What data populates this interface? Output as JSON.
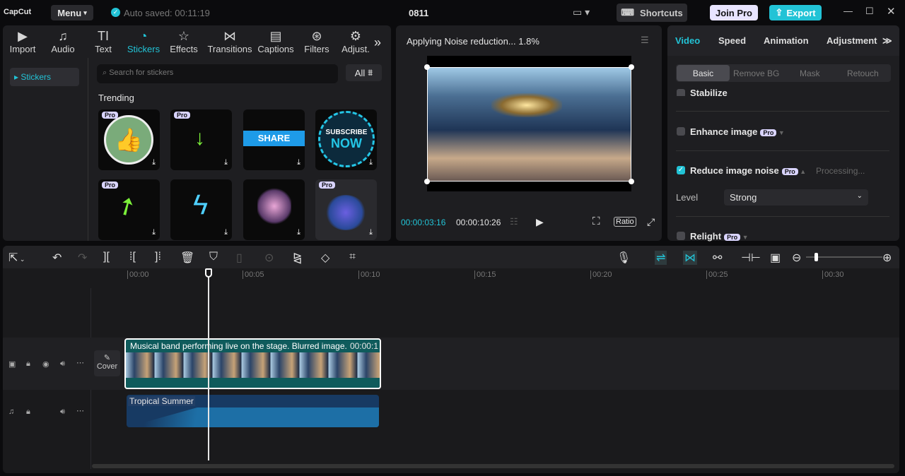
{
  "app": {
    "logo": "CapCut",
    "menu": "Menu",
    "autosave": "Auto saved: 00:11:19",
    "project": "0811",
    "shortcuts": "Shortcuts",
    "join_pro": "Join Pro",
    "export": "Export"
  },
  "toolbar": [
    {
      "label": "Import",
      "icon": "import-icon"
    },
    {
      "label": "Audio",
      "icon": "audio-icon"
    },
    {
      "label": "Text",
      "icon": "text-icon"
    },
    {
      "label": "Stickers",
      "icon": "stickers-icon"
    },
    {
      "label": "Effects",
      "icon": "effects-icon"
    },
    {
      "label": "Transitions",
      "icon": "transitions-icon"
    },
    {
      "label": "Captions",
      "icon": "captions-icon"
    },
    {
      "label": "Filters",
      "icon": "filters-icon"
    },
    {
      "label": "Adjust.",
      "icon": "adjust-icon"
    }
  ],
  "stickers": {
    "side_item": "Stickers",
    "search_placeholder": "Search for stickers",
    "filter": "All",
    "section": "Trending",
    "pro": "Pro",
    "share": "SHARE",
    "subscribe": "SUBSCRIBE",
    "now": "NOW"
  },
  "preview": {
    "status": "Applying Noise reduction... 1.8%",
    "current": "00:00:03:16",
    "total": "00:00:10:26",
    "ratio": "Ratio"
  },
  "right": {
    "tabs": [
      "Video",
      "Speed",
      "Animation",
      "Adjustment"
    ],
    "subtabs": [
      "Basic",
      "Remove BG",
      "Mask",
      "Retouch"
    ],
    "stabilize": "Stabilize",
    "enhance": "Enhance image",
    "reduce": "Reduce image noise",
    "processing": "Processing...",
    "level_label": "Level",
    "level_value": "Strong",
    "relight": "Relight",
    "pro": "Pro"
  },
  "timeline": {
    "ticks": [
      "00:00",
      "00:05",
      "00:10",
      "00:15",
      "00:20",
      "00:25",
      "00:30"
    ],
    "cover": "Cover",
    "video_clip": "Musical band performing live on the stage. Blurred image.",
    "video_dur": "00:00:1",
    "audio_clip": "Tropical Summer"
  },
  "colors": {
    "accent": "#22c3d6",
    "video_clip": "#0f5b5c",
    "audio_clip": "#173a63"
  }
}
